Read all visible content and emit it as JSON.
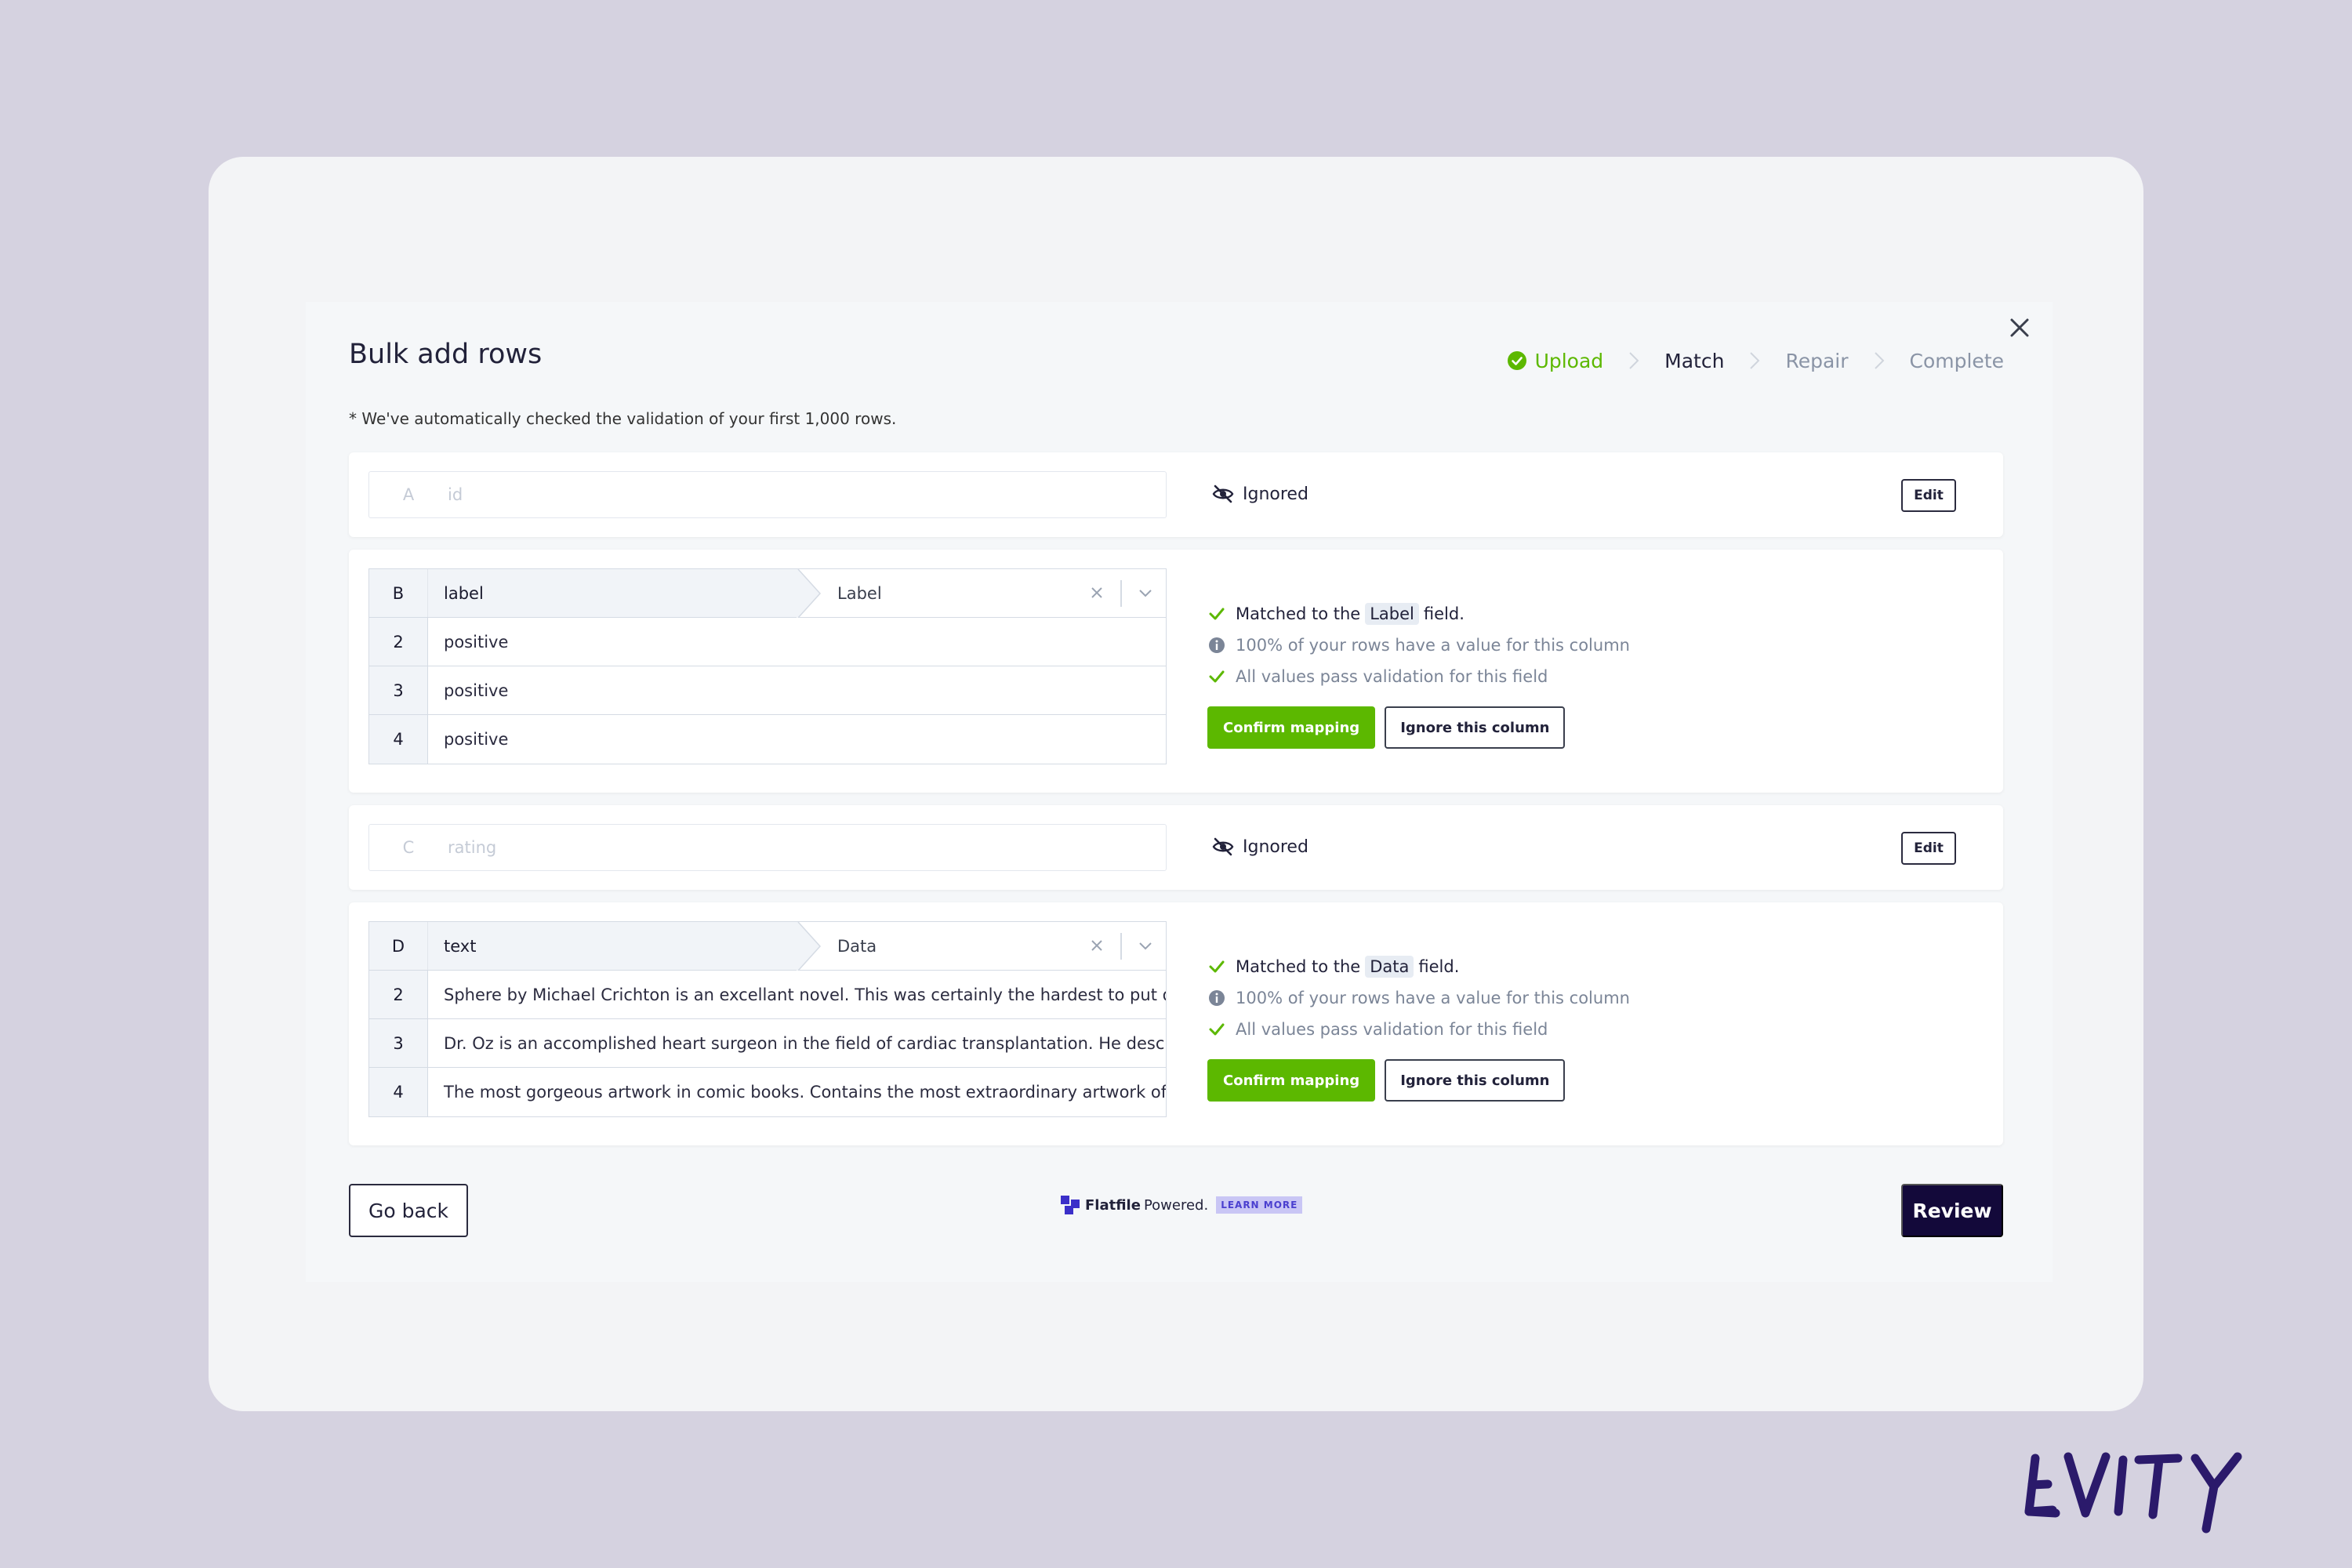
{
  "modal": {
    "title": "Bulk add rows",
    "note": "* We've automatically checked the validation of your first 1,000 rows."
  },
  "steps": [
    {
      "label": "Upload",
      "state": "done"
    },
    {
      "label": "Match",
      "state": "active"
    },
    {
      "label": "Repair",
      "state": "pending"
    },
    {
      "label": "Complete",
      "state": "pending"
    }
  ],
  "columns": [
    {
      "letter": "A",
      "name": "id",
      "status": "Ignored",
      "edit_label": "Edit"
    },
    {
      "letter": "B",
      "name": "label",
      "matched_field": "Label",
      "rows": [
        {
          "num": "2",
          "value": "positive"
        },
        {
          "num": "3",
          "value": "positive"
        },
        {
          "num": "4",
          "value": "positive"
        }
      ],
      "info": {
        "matched_prefix": "Matched to the",
        "matched_suffix": "field.",
        "coverage": "100% of your rows have a value for this column",
        "validation": "All values pass validation for this field"
      },
      "confirm_label": "Confirm mapping",
      "ignore_label": "Ignore this column"
    },
    {
      "letter": "C",
      "name": "rating",
      "status": "Ignored",
      "edit_label": "Edit"
    },
    {
      "letter": "D",
      "name": "text",
      "matched_field": "Data",
      "rows": [
        {
          "num": "2",
          "value": "Sphere by Michael Crichton is an excellant novel. This was certainly the hardest to put down of"
        },
        {
          "num": "3",
          "value": "Dr. Oz is an accomplished heart surgeon in the field of cardiac transplantation. He describes his"
        },
        {
          "num": "4",
          "value": "The most gorgeous artwork in comic books. Contains the most extraordinary artwork of Alex Ross"
        }
      ],
      "info": {
        "matched_prefix": "Matched to the",
        "matched_suffix": "field.",
        "coverage": "100% of your rows have a value for this column",
        "validation": "All values pass validation for this field"
      },
      "confirm_label": "Confirm mapping",
      "ignore_label": "Ignore this column"
    }
  ],
  "footer": {
    "go_back": "Go back",
    "review": "Review",
    "powered_brand": "Flatfile",
    "powered_text": "Powered.",
    "learn_more": "LEARN MORE"
  },
  "logo": {
    "text": "LEVITY",
    "color": "#2b1a6b"
  },
  "colors": {
    "accent_green": "#5cb800",
    "primary_dark": "#13093a",
    "background": "#d5d2e0"
  }
}
